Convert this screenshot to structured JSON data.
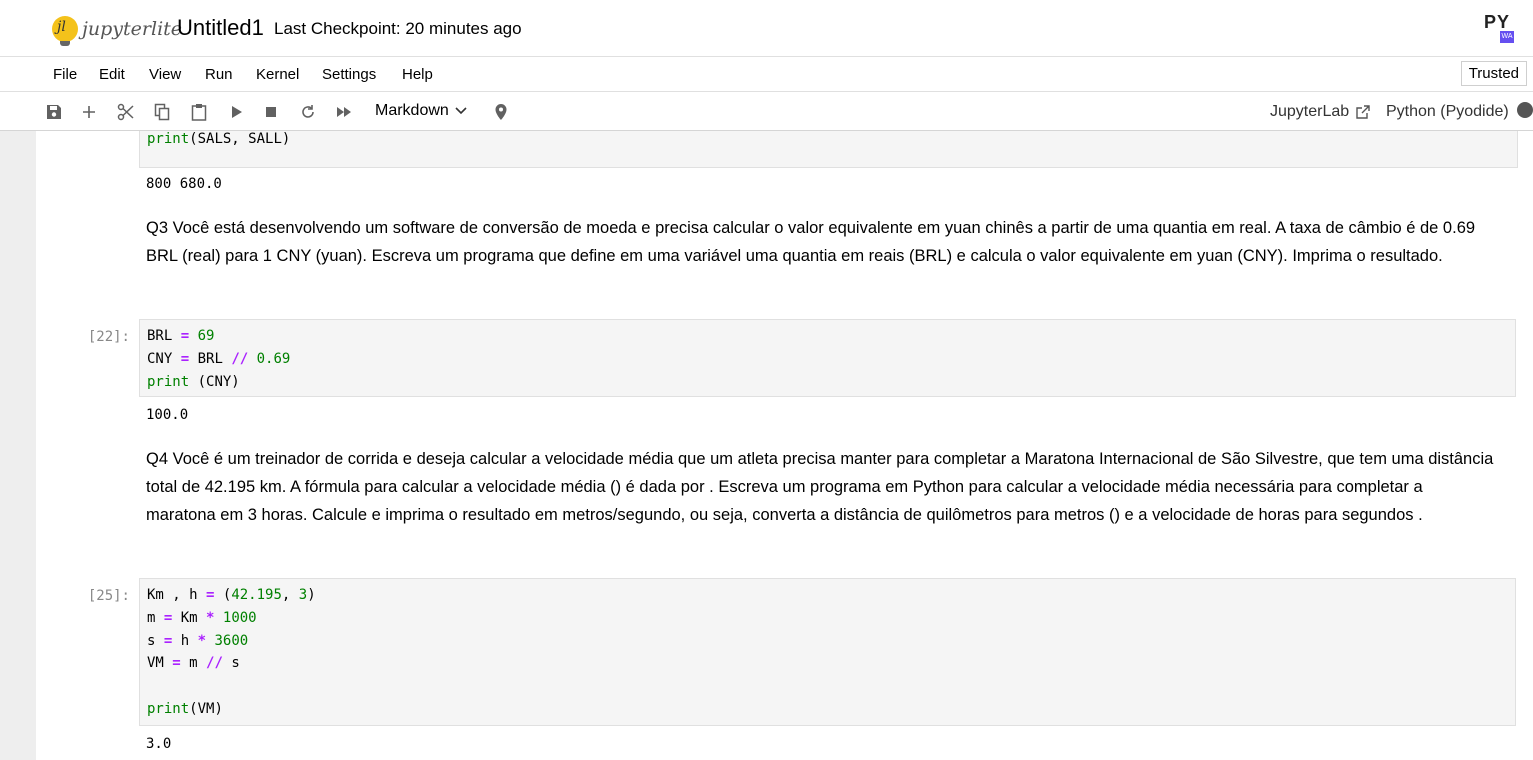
{
  "header": {
    "logo_text": "jupyterlite",
    "logo_mark": "jl",
    "notebook_title": "Untitled1",
    "checkpoint": "Last Checkpoint: 20 minutes ago",
    "badge_text": "PY",
    "badge_sub": "WA"
  },
  "menu": {
    "items": [
      "File",
      "Edit",
      "View",
      "Run",
      "Kernel",
      "Settings",
      "Help"
    ],
    "trusted": "Trusted"
  },
  "toolbar": {
    "cell_type": "Markdown",
    "jupyterlab_link": "JupyterLab",
    "kernel_name": "Python (Pyodide)"
  },
  "cells": {
    "c0": {
      "code": [
        "print(SALS, SALL)"
      ],
      "output": "800 680.0"
    },
    "q3": {
      "text": "Q3 Você está desenvolvendo um software de conversão de moeda e precisa calcular o valor equivalente em yuan chinês a partir de uma quantia em real. A taxa de câmbio é de 0.69 BRL (real) para 1 CNY (yuan). Escreva um programa que define em uma variável uma quantia em reais (BRL) e calcula o valor equivalente em yuan (CNY). Imprima o resultado."
    },
    "c1": {
      "prompt": "[22]:",
      "code": [
        "BRL = 69",
        "CNY = BRL // 0.69",
        "print (CNY)"
      ],
      "output": "100.0"
    },
    "q4": {
      "text": "Q4 Você é um treinador de corrida e deseja calcular a velocidade média que um atleta precisa manter para completar a Maratona Internacional de São Silvestre, que tem uma distância total de 42.195 km. A fórmula para calcular a velocidade média () é dada por . Escreva um programa em Python para calcular a velocidade média necessária para completar a maratona em 3 horas. Calcule e imprima o resultado em metros/segundo, ou seja, converta a distância de quilômetros para metros () e a velocidade de horas para segundos ."
    },
    "c2": {
      "prompt": "[25]:",
      "code": [
        "Km , h = (42.195, 3)",
        "m = Km * 1000",
        "s = h * 3600",
        "VM = m // s",
        "",
        "print(VM)"
      ],
      "output": "3.0"
    }
  }
}
